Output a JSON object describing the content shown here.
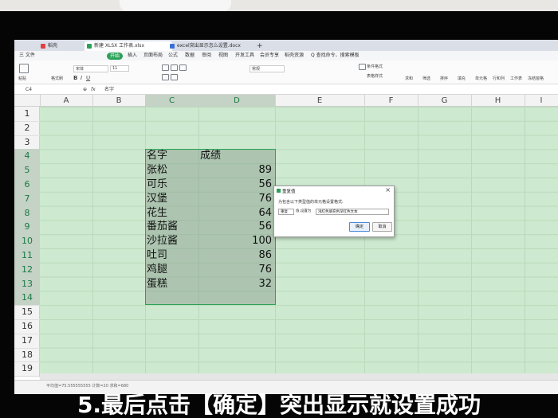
{
  "window": {
    "tabs": [
      {
        "label": "稻壳",
        "icon": "docer-icon",
        "color": "#e04040"
      },
      {
        "label": "新建 XLSX 工作表.xlsx",
        "icon": "xlsx-icon",
        "color": "#2aa158",
        "active": true
      },
      {
        "label": "excel突出显示怎么设置.docx",
        "icon": "docx-icon",
        "color": "#3a6fd8"
      }
    ],
    "new_tab": "+"
  },
  "menu": {
    "file": "三 文件",
    "items": [
      "开始",
      "插入",
      "页面布局",
      "公式",
      "数据",
      "审阅",
      "视图",
      "开发工具",
      "会员专享",
      "稻壳资源"
    ],
    "search": "Q 查找命令、搜索模板"
  },
  "ribbon": {
    "clipboard": [
      "粘贴",
      "格式刷"
    ],
    "font_name": "宋体",
    "font_size": "11",
    "number_format": "常规",
    "groups_right": [
      "条件格式",
      "表格样式",
      "求和",
      "筛选",
      "排序",
      "填充",
      "单元格",
      "行和列",
      "工作表",
      "冻结窗格"
    ]
  },
  "formula_bar": {
    "name_box": "C4",
    "fx": "fx",
    "value": "名字"
  },
  "grid": {
    "columns": [
      "A",
      "B",
      "C",
      "D",
      "E",
      "F",
      "G",
      "H",
      "I"
    ],
    "selected_columns": [
      "C",
      "D"
    ],
    "rows": [
      "1",
      "2",
      "3",
      "4",
      "5",
      "6",
      "7",
      "8",
      "9",
      "10",
      "11",
      "12",
      "13",
      "14",
      "15",
      "16",
      "17",
      "18",
      "19"
    ],
    "selected_rows": [
      "4",
      "5",
      "6",
      "7",
      "8",
      "9",
      "10",
      "11",
      "12",
      "13",
      "14"
    ],
    "header": {
      "name": "名字",
      "score": "成绩"
    },
    "records": [
      {
        "name": "张松",
        "score": "89"
      },
      {
        "name": "可乐",
        "score": "56"
      },
      {
        "name": "汉堡",
        "score": "76"
      },
      {
        "name": "花生",
        "score": "64"
      },
      {
        "name": "番茄酱",
        "score": "56"
      },
      {
        "name": "沙拉酱",
        "score": "100"
      },
      {
        "name": "吐司",
        "score": "86"
      },
      {
        "name": "鸡腿",
        "score": "76"
      },
      {
        "name": "蛋糕",
        "score": "32"
      }
    ]
  },
  "dialog": {
    "title": "重复值",
    "close": "×",
    "description": "为包含以下类型值的单元格设置格式:",
    "type_option": "重复",
    "value_label": "值,设置为",
    "format_option": "浅红色填充色深红色文本",
    "ok": "确定",
    "cancel": "取消"
  },
  "statusbar": {
    "left": "平均值=75.555555555 计数=20 求和=680"
  },
  "caption": "5.最后点击【确定】突出显示就设置成功"
}
